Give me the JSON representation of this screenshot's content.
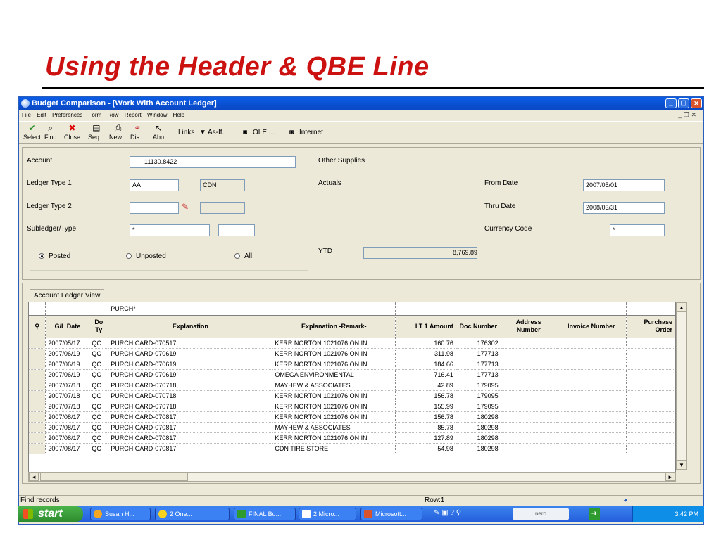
{
  "slide": {
    "title": "Using the Header & QBE Line"
  },
  "window": {
    "title": "Budget Comparison - [Work With Account Ledger]",
    "min": "_",
    "max": "❐",
    "close": "✕",
    "menu": [
      "File",
      "Edit",
      "Preferences",
      "Form",
      "Row",
      "Report",
      "Window",
      "Help"
    ],
    "mdi_controls": "_ ❐ ✕"
  },
  "toolbar": {
    "select": "Select",
    "find": "Find",
    "close": "Close",
    "seq": "Seq...",
    "new": "New...",
    "dis": "Dis...",
    "abo": "Abo",
    "links": "Links",
    "asif": "As-If...",
    "ole": "OLE ...",
    "internet": "Internet"
  },
  "form": {
    "account_label": "Account",
    "account_value": "11130.8422",
    "account_desc": "Other Supplies",
    "ledger1_label": "Ledger Type 1",
    "ledger1_value": "AA",
    "ledger1_currency": "CDN",
    "ledger1_desc": "Actuals",
    "ledger2_label": "Ledger Type 2",
    "ledger2_value": "",
    "subledger_label": "Subledger/Type",
    "subledger_value": "*",
    "subledger_type": "",
    "from_label": "From Date",
    "from_value": "2007/05/01",
    "thru_label": "Thru Date",
    "thru_value": "2008/03/31",
    "currency_label": "Currency Code",
    "currency_value": "*",
    "posted": "Posted",
    "unposted": "Unposted",
    "all": "All",
    "ytd_label": "YTD",
    "ytd_value": "8,769.89"
  },
  "grid": {
    "tab_label": "Account Ledger View",
    "qbe": {
      "explanation": "PURCH*"
    },
    "headers": [
      "G/L Date",
      "Do Ty",
      "Explanation",
      "Explanation -Remark-",
      "LT 1 Amount",
      "Doc Number",
      "Address Number",
      "Invoice Number",
      "Purchase Order"
    ],
    "rows": [
      [
        "2007/05/17",
        "QC",
        "PURCH CARD-070517",
        "KERR NORTON 1021076 ON IN",
        "160.76",
        "176302"
      ],
      [
        "2007/06/19",
        "QC",
        "PURCH CARD-070619",
        "KERR NORTON 1021076 ON IN",
        "311.98",
        "177713"
      ],
      [
        "2007/06/19",
        "QC",
        "PURCH CARD-070619",
        "KERR NORTON 1021076 ON IN",
        "184.66",
        "177713"
      ],
      [
        "2007/06/19",
        "QC",
        "PURCH CARD-070619",
        "OMEGA ENVIRONMENTAL",
        "716.41",
        "177713"
      ],
      [
        "2007/07/18",
        "QC",
        "PURCH CARD-070718",
        "MAYHEW & ASSOCIATES",
        "42.89",
        "179095"
      ],
      [
        "2007/07/18",
        "QC",
        "PURCH CARD-070718",
        "KERR NORTON 1021076 ON IN",
        "156.78",
        "179095"
      ],
      [
        "2007/07/18",
        "QC",
        "PURCH CARD-070718",
        "KERR NORTON 1021076 ON IN",
        "155.99",
        "179095"
      ],
      [
        "2007/08/17",
        "QC",
        "PURCH CARD-070817",
        "KERR NORTON 1021076 ON IN",
        "156.78",
        "180298"
      ],
      [
        "2007/08/17",
        "QC",
        "PURCH CARD-070817",
        "MAYHEW & ASSOCIATES",
        "85.78",
        "180298"
      ],
      [
        "2007/08/17",
        "QC",
        "PURCH CARD-070817",
        "KERR NORTON 1021076 ON IN",
        "127.89",
        "180298"
      ],
      [
        "2007/08/17",
        "QC",
        "PURCH CARD-070817",
        "CDN TIRE STORE",
        "54.98",
        "180298"
      ]
    ]
  },
  "status": {
    "left": "Find records",
    "row": "Row:1"
  },
  "taskbar": {
    "start": "start",
    "tasks": [
      "Susan H...",
      "2 One...",
      "FINAL Bu...",
      "2 Micro...",
      "Microsoft..."
    ],
    "nero": "nero",
    "clock": "3:42 PM"
  },
  "colors": {
    "title_red": "#cc1111",
    "xp_blue": "#0b5de6",
    "start_green": "#2d8b2d",
    "window_bg": "#ece9d8"
  }
}
